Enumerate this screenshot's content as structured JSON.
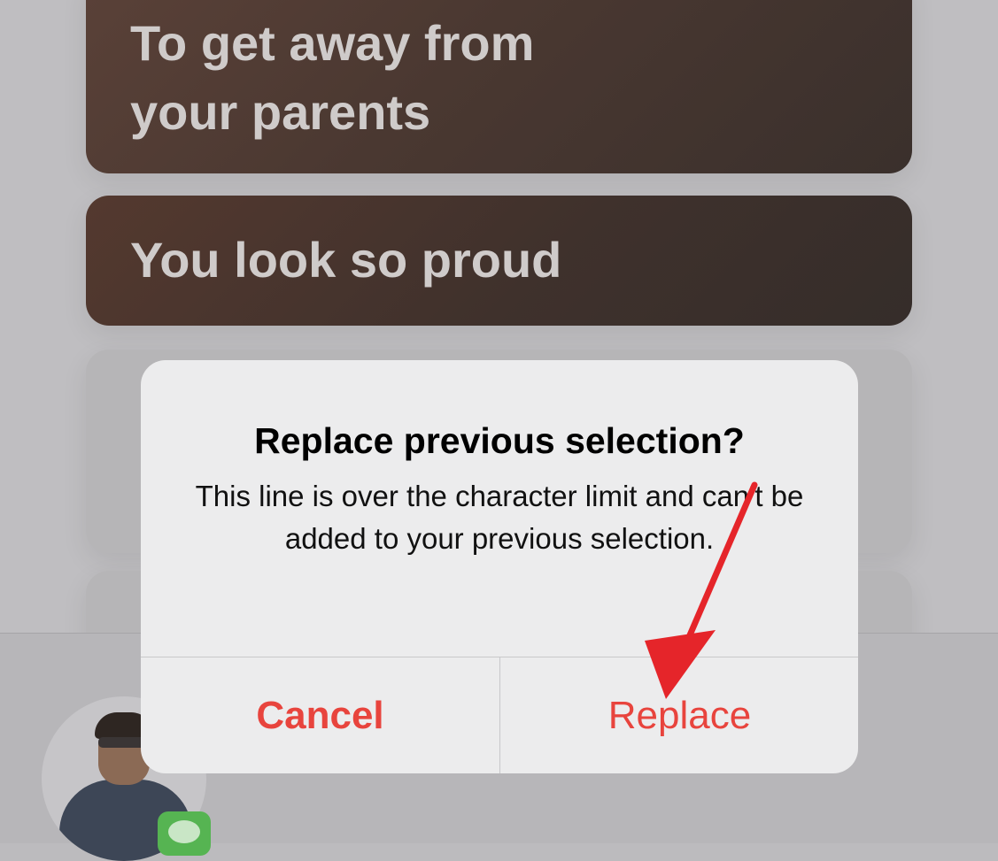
{
  "background_cards": {
    "card1": {
      "line1": "To get away from",
      "line2": "your parents"
    },
    "card2": {
      "line1": "You look so proud"
    }
  },
  "alert": {
    "title": "Replace previous selection?",
    "message": "This line is over the character limit and can't be added to your previous selection.",
    "cancel_label": "Cancel",
    "replace_label": "Replace"
  },
  "colors": {
    "destructive_red": "#e8443d",
    "annotation_arrow": "#e5252a"
  },
  "icons": {
    "messages_badge": "messages-app-icon",
    "avatar": "user-avatar"
  }
}
